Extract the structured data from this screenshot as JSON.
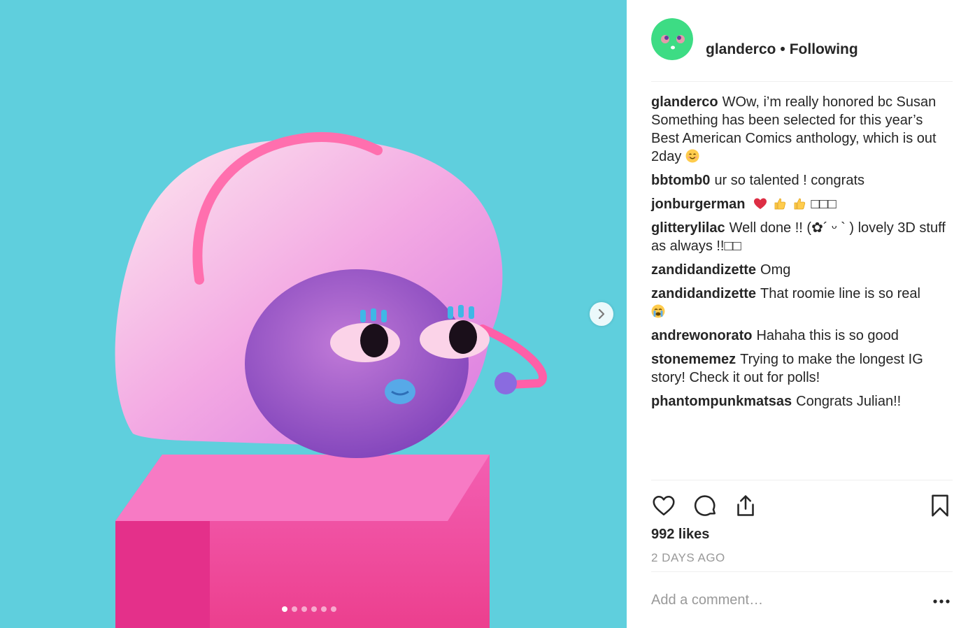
{
  "post": {
    "author": "glanderco",
    "separator": "•",
    "follow_status": "Following",
    "slide_count": 6,
    "active_slide": 0
  },
  "comments": [
    {
      "user": "glanderco",
      "text": "WOw, i’m really honored bc Susan Something has been selected for this year’s Best American Comics anthology, which is out 2day",
      "emoji": "smiling-face-emoji"
    },
    {
      "user": "bbtomb0",
      "text": "ur so talented ! congrats"
    },
    {
      "user": "jonburgerman",
      "text": "",
      "emoji": "heart-thumbs-up-emoji",
      "trailing": "□□□"
    },
    {
      "user": "glitterylilac",
      "text": "Well done !! (✿´ ᵕ ` ) lovely 3D stuff as always !!□□"
    },
    {
      "user": "zandidandizette",
      "text": "Omg"
    },
    {
      "user": "zandidandizette",
      "text": "That roomie line is so real",
      "emoji": "crying-face-emoji"
    },
    {
      "user": "andrewonorato",
      "text": "Hahaha this is so good"
    },
    {
      "user": "stonememez",
      "text": "Trying to make the longest IG story! Check it out for polls!"
    },
    {
      "user": "phantompunkmatsas",
      "text": "Congrats Julian!!"
    }
  ],
  "stats": {
    "likes": "992 likes",
    "time_ago": "2 DAYS AGO"
  },
  "comment_box": {
    "placeholder": "Add a comment…"
  },
  "icons": {
    "like": "heart-icon",
    "comment": "comment-icon",
    "share": "share-icon",
    "save": "bookmark-icon",
    "more": "more-options-icon",
    "next": "chevron-right-icon"
  },
  "colors": {
    "media_bg": "#5fcfdd",
    "avatar_bg": "#3ddc84",
    "text": "#262626",
    "muted": "#999999"
  }
}
